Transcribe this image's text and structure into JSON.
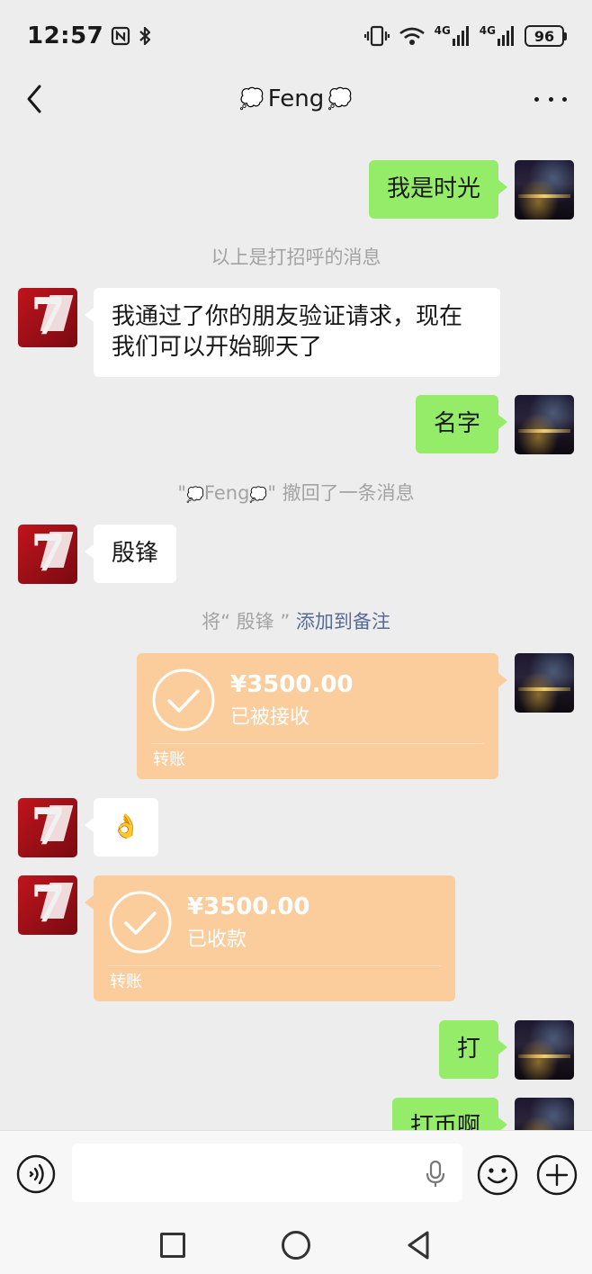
{
  "status_bar": {
    "time": "12:57",
    "battery": "96",
    "network_1": "4G",
    "network_2": "4G"
  },
  "nav": {
    "title": "Feng",
    "title_emoji": "💭"
  },
  "messages": {
    "m1": "我是时光",
    "sys1": "以上是打招呼的消息",
    "m2": "我通过了你的朋友验证请求，现在我们可以开始聊天了",
    "m3": "名字",
    "sys2_prefix": "\"",
    "sys2_name": "Feng",
    "sys2_suffix": "\" 撤回了一条消息",
    "m4": "殷锋",
    "sys3_prefix": "将“ 殷锋 ” ",
    "sys3_link": "添加到备注",
    "t1_amount": "¥3500.00",
    "t1_status": "已被接收",
    "t1_type": "转账",
    "m5": "👌",
    "t2_amount": "¥3500.00",
    "t2_status": "已收款",
    "t2_type": "转账",
    "m6": "打",
    "m7": "打币啊"
  },
  "colors": {
    "my_bubble": "#95ec69",
    "other_bubble": "#ffffff",
    "transfer": "#fbcd9c",
    "link": "#576b95",
    "background": "#ededed"
  },
  "icons": {
    "back": "chevron-left-icon",
    "more": "more-dots-icon",
    "voice": "voice-icon",
    "mic": "microphone-icon",
    "emoji": "emoji-icon",
    "plus": "plus-icon",
    "check": "check-circle-icon"
  }
}
